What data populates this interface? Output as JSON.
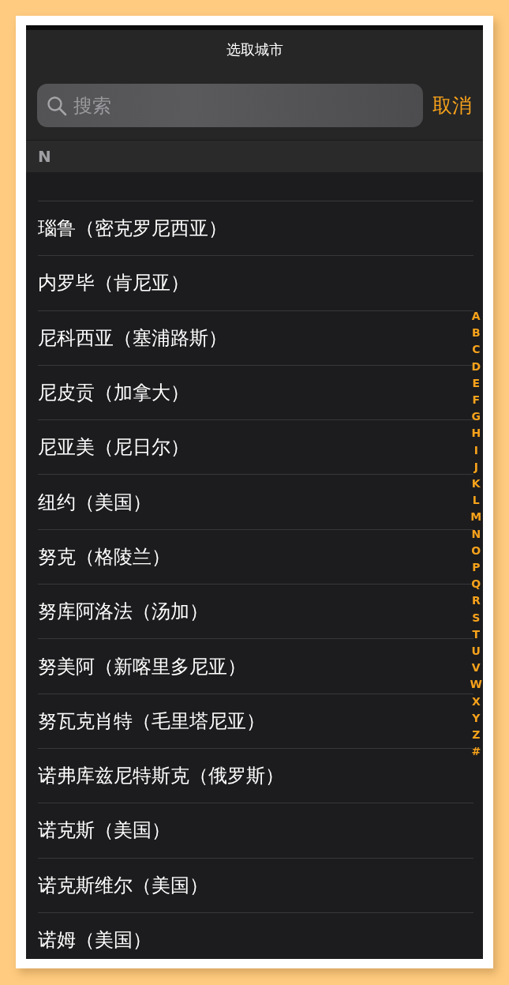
{
  "title": "选取城市",
  "search": {
    "placeholder": "搜索"
  },
  "cancel": "取消",
  "section": "N",
  "cities": [
    "瑙鲁（密克罗尼西亚）",
    "内罗毕（肯尼亚）",
    "尼科西亚（塞浦路斯）",
    "尼皮贡（加拿大）",
    "尼亚美（尼日尔）",
    "纽约（美国）",
    "努克（格陵兰）",
    "努库阿洛法（汤加）",
    "努美阿（新喀里多尼亚）",
    "努瓦克肖特（毛里塔尼亚）",
    "诺弗库兹尼特斯克（俄罗斯）",
    "诺克斯（美国）",
    "诺克斯维尔（美国）",
    "诺姆（美国）"
  ],
  "index": [
    "A",
    "B",
    "C",
    "D",
    "E",
    "F",
    "G",
    "H",
    "I",
    "J",
    "K",
    "L",
    "M",
    "N",
    "O",
    "P",
    "Q",
    "R",
    "S",
    "T",
    "U",
    "V",
    "W",
    "X",
    "Y",
    "Z",
    "#"
  ]
}
